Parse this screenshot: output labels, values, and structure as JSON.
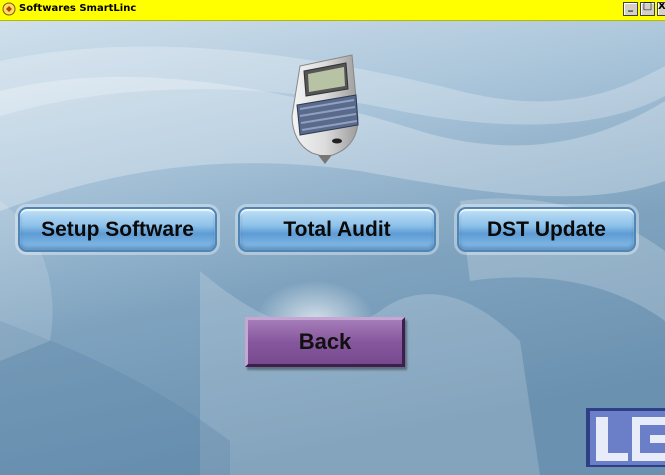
{
  "window": {
    "title": "Softwares SmartLinc",
    "minimize_label": "_",
    "restore_label": "□",
    "close_label": "X"
  },
  "menu": {
    "setup_label": "Setup Software",
    "audit_label": "Total Audit",
    "dst_label": "DST Update",
    "back_label": "Back"
  },
  "logo": {
    "text": "LG"
  },
  "colors": {
    "titlebar": "#ffff00",
    "button_blue": "#6fa8dc",
    "button_purple": "#8e5fa6",
    "logo": "#5a6fb8"
  }
}
